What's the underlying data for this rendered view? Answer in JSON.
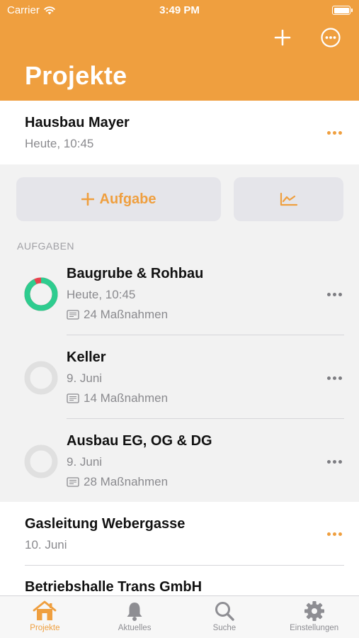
{
  "status_bar": {
    "carrier": "Carrier",
    "time": "3:49 PM"
  },
  "header": {
    "title": "Projekte",
    "add_icon": "plus-icon",
    "more_icon": "ellipsis-circle-icon"
  },
  "active_project": {
    "name": "Hausbau Mayer",
    "subtitle": "Heute, 10:45"
  },
  "actions": {
    "add_task_label": "Aufgabe",
    "chart_icon": "chart-icon"
  },
  "tasks_section": {
    "header": "AUFGABEN"
  },
  "tasks": [
    {
      "name": "Baugrube & Rohbau",
      "date": "Heute, 10:45",
      "count": "24 Maßnahmen",
      "progress": 0.93
    },
    {
      "name": "Keller",
      "date": "9. Juni",
      "count": "14 Maßnahmen",
      "progress": 0
    },
    {
      "name": "Ausbau EG, OG & DG",
      "date": "9. Juni",
      "count": "28 Maßnahmen",
      "progress": 0
    }
  ],
  "other_projects": [
    {
      "name": "Gasleitung Webergasse",
      "subtitle": "10. Juni"
    },
    {
      "name": "Betriebshalle Trans GmbH",
      "subtitle": ""
    }
  ],
  "tabs": [
    {
      "label": "Projekte",
      "icon": "house-icon",
      "active": true
    },
    {
      "label": "Aktuelles",
      "icon": "bell-icon",
      "active": false
    },
    {
      "label": "Suche",
      "icon": "search-icon",
      "active": false
    },
    {
      "label": "Einstellungen",
      "icon": "gear-icon",
      "active": false
    }
  ],
  "colors": {
    "accent": "#ef9f3f",
    "progress_green": "#2ecc8f",
    "progress_red": "#e8434f",
    "ring_empty": "#e0e0e0"
  }
}
